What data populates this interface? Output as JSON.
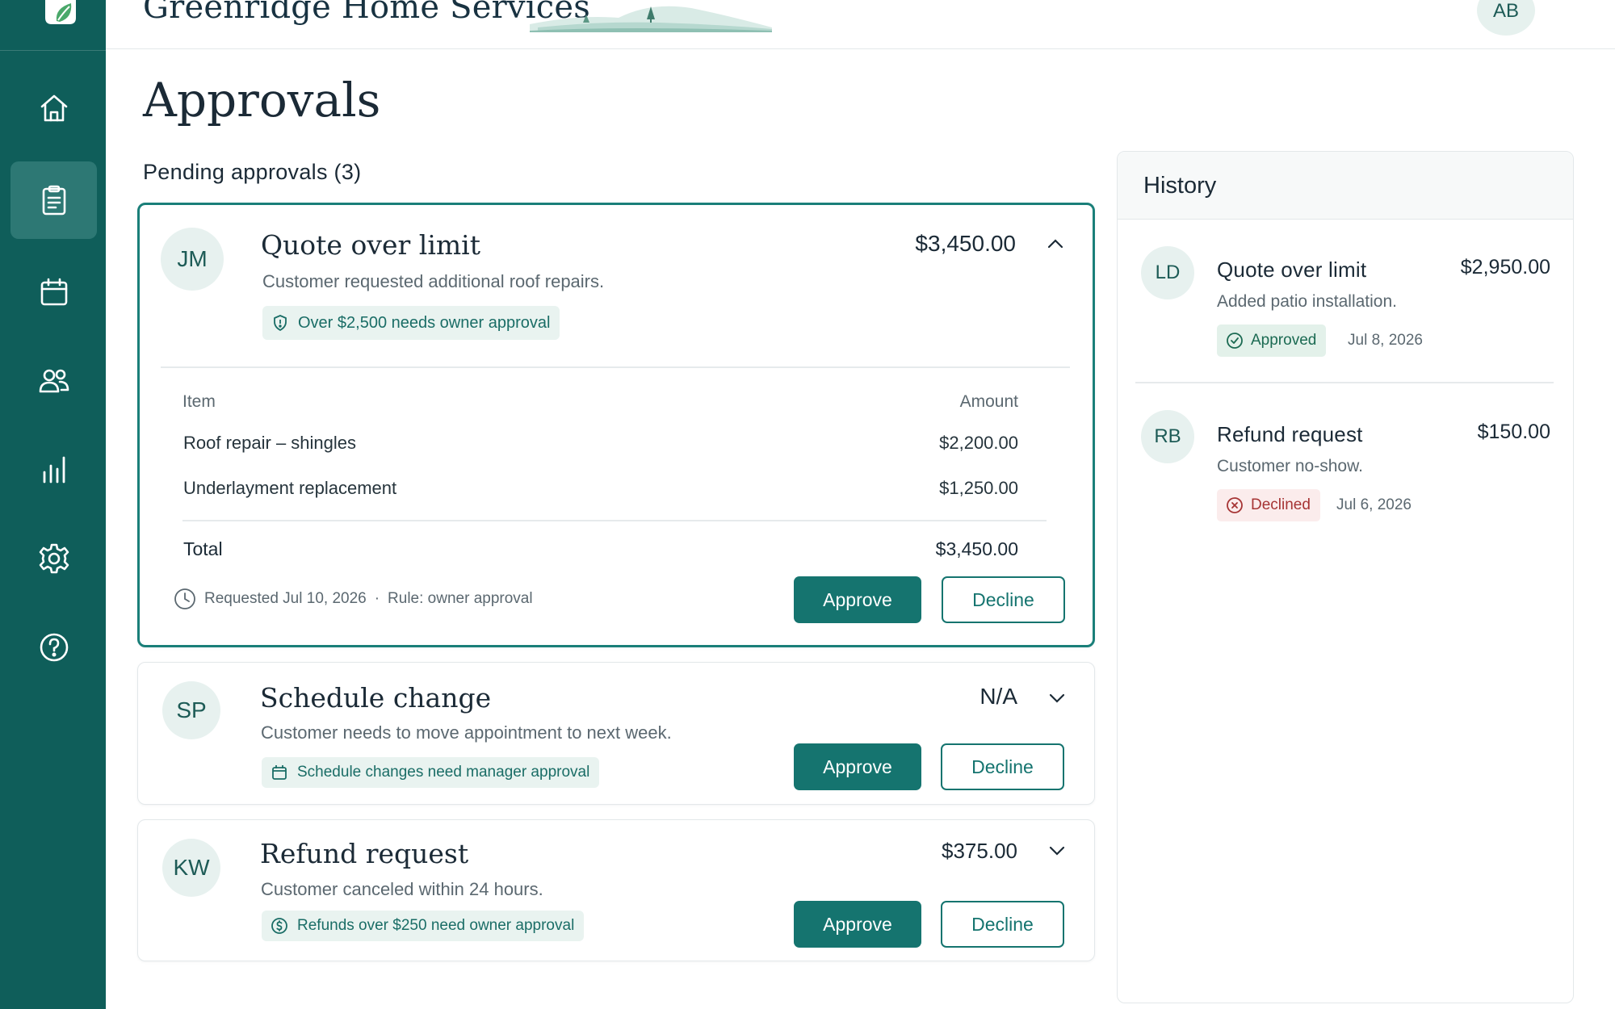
{
  "header": {
    "brand": "Greenridge Home Services",
    "user_initials": "AB"
  },
  "sidebar": {
    "items": [
      {
        "name": "home",
        "icon": "home-icon",
        "active": false
      },
      {
        "name": "approvals",
        "icon": "clipboard-icon",
        "active": true
      },
      {
        "name": "calendar",
        "icon": "calendar-icon",
        "active": false
      },
      {
        "name": "customers",
        "icon": "users-icon",
        "active": false
      },
      {
        "name": "reports",
        "icon": "bar-chart-icon",
        "active": false
      },
      {
        "name": "settings",
        "icon": "gear-icon",
        "active": false
      },
      {
        "name": "help",
        "icon": "help-icon",
        "active": false
      }
    ]
  },
  "page": {
    "title": "Approvals",
    "pending_label": "Pending approvals (3)"
  },
  "pending": [
    {
      "initials": "JM",
      "title": "Quote over limit",
      "amount": "$3,450.00",
      "description": "Customer requested additional roof repairs.",
      "rule": "Over $2,500 needs owner approval",
      "rule_icon": "shield-icon",
      "expanded": true,
      "table": {
        "col_item": "Item",
        "col_amount": "Amount",
        "rows": [
          {
            "item": "Roof repair – shingles",
            "amount": "$2,200.00"
          },
          {
            "item": "Underlayment replacement",
            "amount": "$1,250.00"
          }
        ],
        "total_label": "Total",
        "total_value": "$3,450.00"
      },
      "requested": "Requested Jul 10, 2026",
      "separator": "·",
      "rule_meta": "Rule: owner approval",
      "approve_label": "Approve",
      "decline_label": "Decline"
    },
    {
      "initials": "SP",
      "title": "Schedule change",
      "amount": "N/A",
      "description": "Customer needs to move appointment to next week.",
      "rule": "Schedule changes need manager approval",
      "rule_icon": "calendar-icon",
      "expanded": false,
      "approve_label": "Approve",
      "decline_label": "Decline"
    },
    {
      "initials": "KW",
      "title": "Refund request",
      "amount": "$375.00",
      "description": "Customer canceled within 24 hours.",
      "rule": "Refunds over $250 need owner approval",
      "rule_icon": "dollar-circle-icon",
      "expanded": false,
      "approve_label": "Approve",
      "decline_label": "Decline"
    }
  ],
  "history": {
    "title": "History",
    "items": [
      {
        "initials": "LD",
        "title": "Quote over limit",
        "amount": "$2,950.00",
        "description": "Added patio installation.",
        "status": "Approved",
        "date": "Jul 8, 2026"
      },
      {
        "initials": "RB",
        "title": "Refund request",
        "amount": "$150.00",
        "description": "Customer no-show.",
        "status": "Declined",
        "date": "Jul 6, 2026"
      }
    ]
  },
  "colors": {
    "sidebar": "#0f5e5a",
    "accent": "#15746f",
    "approved": "#1b6a52",
    "declined": "#a63434"
  }
}
